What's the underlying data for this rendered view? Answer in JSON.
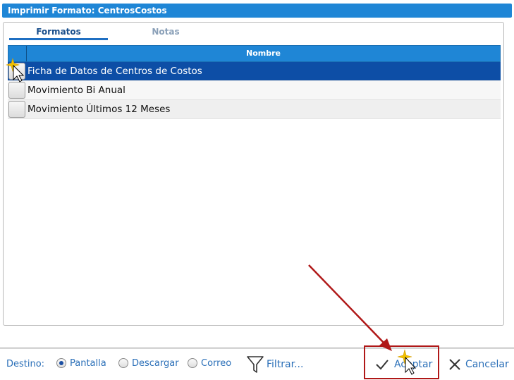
{
  "window": {
    "title": "Imprimir Formato: CentrosCostos"
  },
  "tabs": [
    {
      "label": "Formatos",
      "active": true
    },
    {
      "label": "Notas",
      "active": false
    }
  ],
  "grid": {
    "column_header": "Nombre",
    "rows": [
      {
        "name": "Ficha de Datos de Centros de Costos",
        "selected": true
      },
      {
        "name": "Movimiento Bi Anual",
        "selected": false
      },
      {
        "name": "Movimiento Últimos 12 Meses",
        "selected": false
      }
    ]
  },
  "footer": {
    "destino_label": "Destino:",
    "options": [
      {
        "label": "Pantalla",
        "checked": true
      },
      {
        "label": "Descargar",
        "checked": false
      },
      {
        "label": "Correo",
        "checked": false
      }
    ],
    "filter_label": "Filtrar...",
    "accept_label": "Aceptar",
    "cancel_label": "Cancelar"
  },
  "colors": {
    "title_bar": "#1f86d6",
    "selected_row": "#0d4ea6",
    "link_text": "#2a6fb8",
    "highlight_box": "#b01818"
  }
}
